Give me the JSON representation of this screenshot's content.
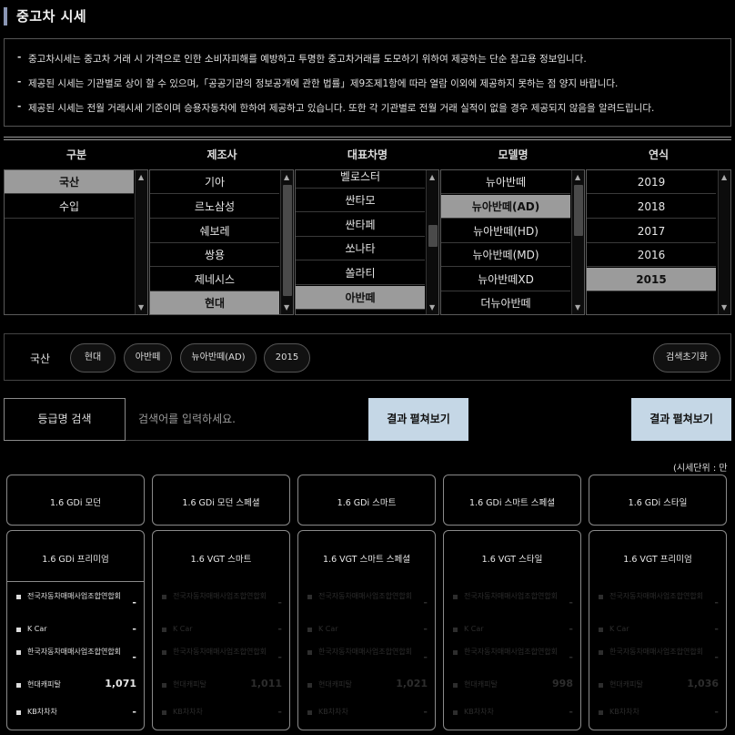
{
  "page": {
    "title": "중고차 시세"
  },
  "notices": [
    "중고차시세는 중고차 거래 시 가격으로 인한 소비자피해를 예방하고 투명한 중고차거래를 도모하기 위하여 제공하는 단순 참고용 정보입니다.",
    "제공된 시세는 기관별로 상이 할 수 있으며,「공공기관의 정보공개에 관한 법률」제9조제1항에 따라 열람 이외에 제공하지 못하는 점 양지 바랍니다.",
    "제공된 시세는 전월 거래시세 기준이며 승용자동차에 한하여 제공하고 있습니다. 또한 각 기관별로 전월 거래 실적이 없을 경우 제공되지 않음을 알려드립니다."
  ],
  "selector": {
    "headers": [
      "구분",
      "제조사",
      "대표차명",
      "모델명",
      "연식"
    ],
    "category": {
      "items": [
        "국산",
        "수입"
      ],
      "selected": "국산"
    },
    "maker": {
      "items": [
        "기아",
        "르노삼성",
        "쉐보레",
        "쌍용",
        "제네시스",
        "현대"
      ],
      "selected": "현대"
    },
    "car": {
      "items": [
        "벨로스터",
        "싼타모",
        "싼타페",
        "쏘나타",
        "쏠라티",
        "아반떼"
      ],
      "selected": "아반떼"
    },
    "model": {
      "items": [
        "뉴아반떼",
        "뉴아반떼(AD)",
        "뉴아반떼(HD)",
        "뉴아반떼(MD)",
        "뉴아반떼XD",
        "더뉴아반떼"
      ],
      "selected": "뉴아반떼(AD)"
    },
    "year": {
      "items": [
        "2019",
        "2018",
        "2017",
        "2016",
        "2015"
      ],
      "selected": "2015"
    }
  },
  "filters": {
    "label": "국산",
    "chips": [
      "현대",
      "아반떼",
      "뉴아반떼(AD)",
      "2015"
    ],
    "reset_label": "검색초기화"
  },
  "search": {
    "label": "등급명 검색",
    "placeholder": "검색어를 입력하세요.",
    "result_button": "결과 펼쳐보기",
    "result_button_right": "결과 펼쳐보기"
  },
  "unit_note": "(시세단위 : 만원)",
  "grades_row1": [
    "1.6 GDi 모던",
    "1.6 GDi 모던 스페셜",
    "1.6 GDi 스마트",
    "1.6 GDi 스마트 스페셜",
    "1.6 GDi 스타일"
  ],
  "grades_row2": [
    {
      "name": "1.6 GDi 프리미엄",
      "prices": [
        "-",
        "-",
        "-",
        "1,071",
        "-"
      ]
    },
    {
      "name": "1.6 VGT 스마트",
      "prices": [
        "-",
        "-",
        "-",
        "1,011",
        "-"
      ]
    },
    {
      "name": "1.6 VGT 스마트 스페셜",
      "prices": [
        "-",
        "-",
        "-",
        "1,021",
        "-"
      ]
    },
    {
      "name": "1.6 VGT 스타일",
      "prices": [
        "-",
        "-",
        "-",
        "998",
        "-"
      ]
    },
    {
      "name": "1.6 VGT 프리미엄",
      "prices": [
        "-",
        "-",
        "-",
        "1,036",
        "-"
      ]
    }
  ],
  "price_sources": [
    "전국자동차매매사업조합연합회",
    "K Car",
    "한국자동차매매사업조합연합회",
    "현대캐피탈",
    "KB차차차"
  ]
}
